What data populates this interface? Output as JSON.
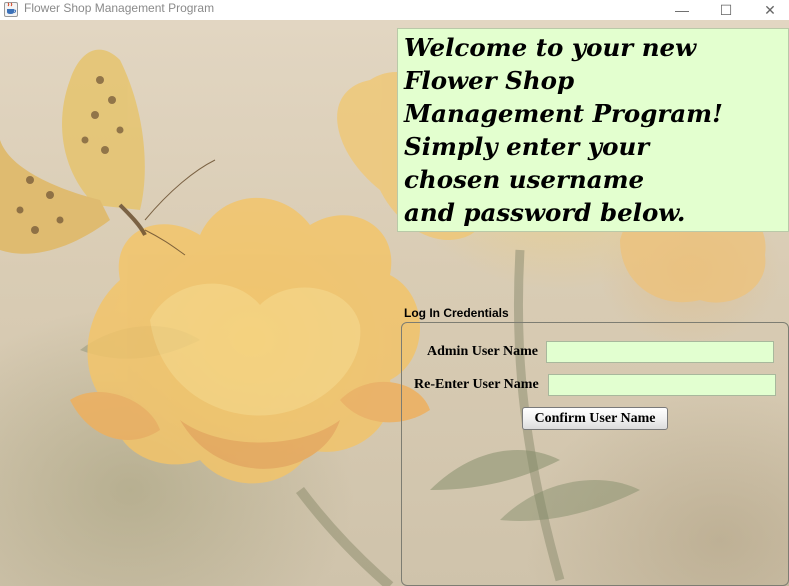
{
  "window": {
    "title": "Flower Shop Management Program",
    "icon": "java-cup-icon",
    "controls": {
      "minimize": "—",
      "maximize": "☐",
      "close": "✕"
    }
  },
  "welcome": {
    "text": "Welcome to your new\nFlower Shop\nManagement Program!\nSimply enter your\nchosen username\nand password below."
  },
  "credentials": {
    "group_title": "Log In Credentials",
    "admin_label": "Admin User Name",
    "admin_value": "",
    "reenter_label": "Re-Enter User Name",
    "reenter_value": "",
    "confirm_label": "Confirm User Name"
  },
  "colors": {
    "panel_bg": "#e3ffcf",
    "field_bg": "#e2ffd0",
    "background_theme": "faded orange flowers with butterfly"
  }
}
